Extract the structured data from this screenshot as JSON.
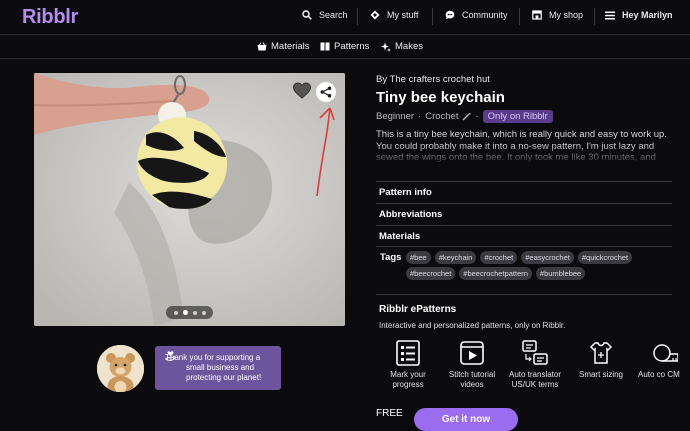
{
  "app": {
    "logo": "Ribblr",
    "accent": "#b58cf2",
    "button_color": "#9b6cf0"
  },
  "nav": {
    "search": "Search",
    "my_stuff": "My stuff",
    "community": "Community",
    "my_shop": "My shop",
    "user": "Hey Marilyn"
  },
  "subnav": {
    "materials": "Materials",
    "patterns": "Patterns",
    "makes": "Makes"
  },
  "gallery": {
    "image_count": 4,
    "active_index": 1
  },
  "pattern": {
    "author": "By The crafters crochet hut",
    "title": "Tiny bee keychain",
    "level": "Beginner",
    "craft": "Crochet",
    "badge": "Only on Ribblr",
    "description": "This is a tiny bee keychain, which is really quick and easy to work up. You could probably make it into a no-sew pattern, I'm just lazy and sewed the wings onto the bee. It only took me like 30 minutes, and"
  },
  "sections": {
    "pattern_info": "Pattern info",
    "abbreviations": "Abbreviations",
    "materials": "Materials",
    "tags_label": "Tags"
  },
  "tags": [
    "#bee",
    "#keychain",
    "#crochet",
    "#easycrochet",
    "#quickcrochet",
    "#beecrochet",
    "#beecrochetpattern",
    "#bumblebee"
  ],
  "epatterns": {
    "title": "Ribblr ePatterns",
    "subtitle": "Interactive and personalized patterns, only on Ribblr.",
    "features": [
      {
        "label": "Mark your progress",
        "icon": "checklist-icon"
      },
      {
        "label": "Stitch tutorial videos",
        "icon": "video-icon"
      },
      {
        "label": "Auto translator US/UK terms",
        "icon": "translate-icon"
      },
      {
        "label": "Smart sizing",
        "icon": "sizing-icon"
      },
      {
        "label": "Auto co CM",
        "icon": "ruler-icon"
      }
    ]
  },
  "purchase": {
    "price": "FREE",
    "button": "Get it now"
  },
  "support": {
    "message": "Thank you for supporting a small business and protecting our planet!"
  }
}
